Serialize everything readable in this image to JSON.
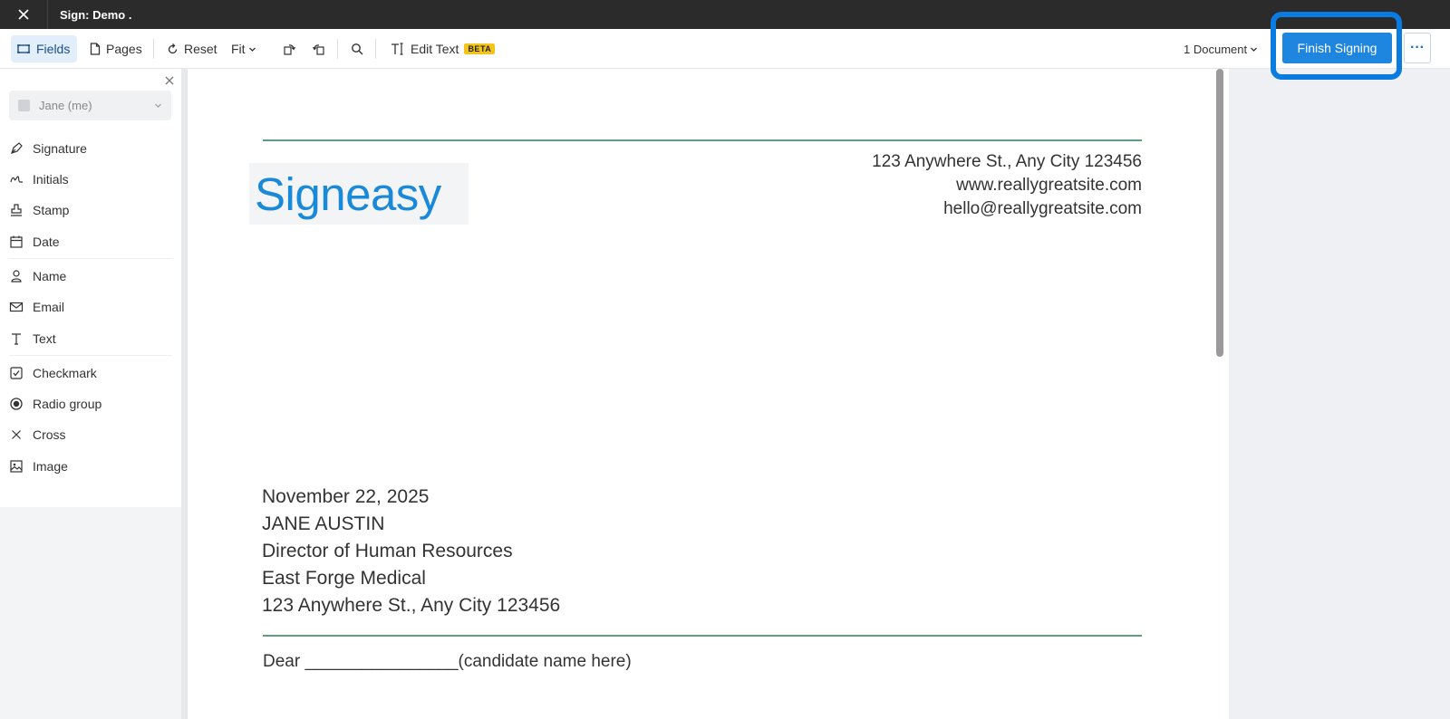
{
  "window": {
    "title": "Sign: Demo ."
  },
  "toolbar": {
    "fields_label": "Fields",
    "pages_label": "Pages",
    "reset_label": "Reset",
    "fit_label": "Fit",
    "edit_text_label": "Edit Text",
    "beta_badge": "BETA",
    "document_count": "1 Document",
    "finish_label": "Finish Signing",
    "more_label": "···",
    "accent_color": "#1f86e0",
    "highlight_color": "#0a7be0"
  },
  "sidebar": {
    "signer": "Jane (me)",
    "items": [
      {
        "label": "Signature",
        "icon": "pen-nib-icon"
      },
      {
        "label": "Initials",
        "icon": "initials-icon"
      },
      {
        "label": "Stamp",
        "icon": "stamp-icon"
      },
      {
        "label": "Date",
        "icon": "calendar-icon"
      },
      {
        "label": "Name",
        "icon": "person-icon"
      },
      {
        "label": "Email",
        "icon": "envelope-icon"
      },
      {
        "label": "Text",
        "icon": "text-icon"
      },
      {
        "label": "Checkmark",
        "icon": "checkbox-icon"
      },
      {
        "label": "Radio group",
        "icon": "radio-icon"
      },
      {
        "label": "Cross",
        "icon": "cross-icon"
      },
      {
        "label": "Image",
        "icon": "image-icon"
      }
    ]
  },
  "document": {
    "logo_text": "Signeasy",
    "address_line": "123 Anywhere St., Any City 123456",
    "website": "www.reallygreatsite.com",
    "email": "hello@reallygreatsite.com",
    "date": "November 22, 2025",
    "recipient_name": "JANE AUSTIN",
    "recipient_title": "Director of Human Resources",
    "recipient_company": "East Forge Medical",
    "recipient_address": "123 Anywhere St., Any City 123456",
    "salutation": "Dear ________________(candidate name here)"
  }
}
